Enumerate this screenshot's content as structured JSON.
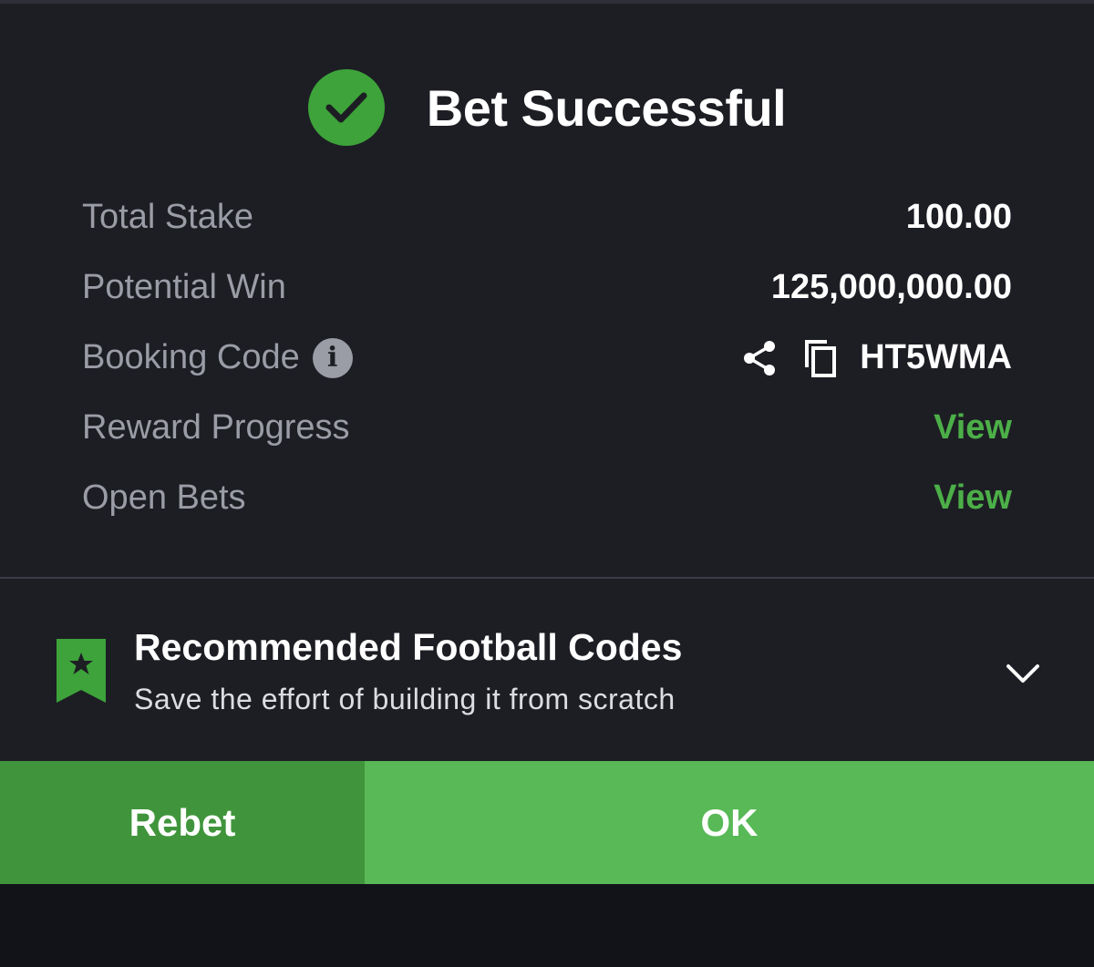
{
  "header": {
    "title": "Bet Successful",
    "icon": "check-circle-icon",
    "icon_color": "#3da33a"
  },
  "details": {
    "total_stake_label": "Total Stake",
    "total_stake_value": "100.00",
    "potential_win_label": "Potential Win",
    "potential_win_value": "125,000,000.00",
    "booking_code_label": "Booking Code",
    "booking_code_value": "HT5WMA",
    "reward_progress_label": "Reward Progress",
    "reward_progress_link": "View",
    "open_bets_label": "Open Bets",
    "open_bets_link": "View"
  },
  "recommend": {
    "title": "Recommended Football Codes",
    "subtitle": "Save the effort of building it from scratch",
    "icon": "bookmark-star-icon"
  },
  "actions": {
    "rebet_label": "Rebet",
    "ok_label": "OK"
  },
  "colors": {
    "accent": "#58b956",
    "accent_dark": "#40953c",
    "link": "#4caf48",
    "background": "#1d1e24"
  }
}
